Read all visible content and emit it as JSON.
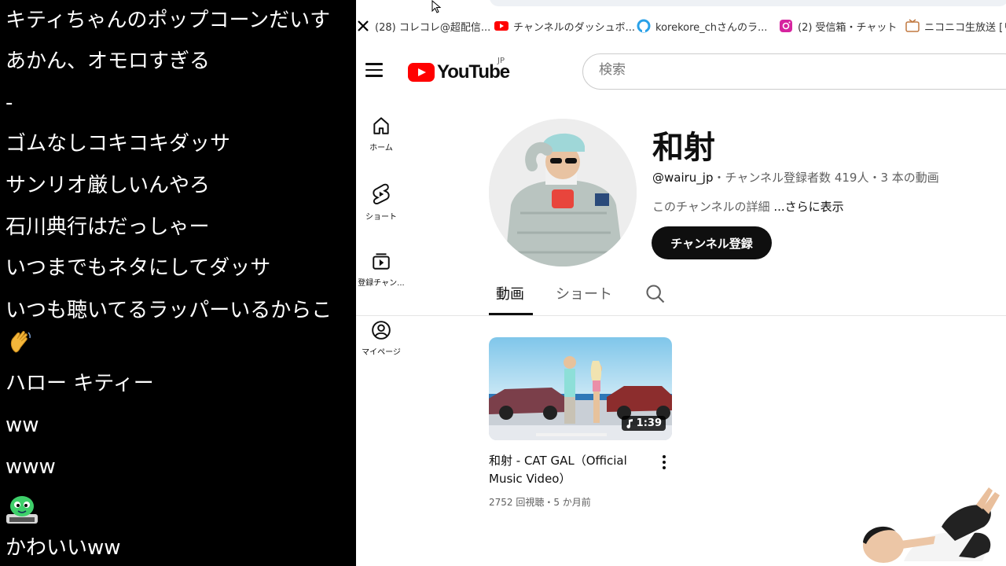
{
  "chat": {
    "messages": [
      {
        "text": "キティちゃんのポップコーンだいす"
      },
      {
        "text": "あかん、オモロすぎる"
      },
      {
        "text": "-"
      },
      {
        "text": "ゴムなしコキコキダッサ"
      },
      {
        "text": "サンリオ厳しいんやろ"
      },
      {
        "text": "石川典行はだっしゃー"
      },
      {
        "text": "いつまでもネタにしてダッサ"
      },
      {
        "text": "いつも聴いてるラッパーいるからこ"
      },
      {
        "text": "ハロー キティー"
      },
      {
        "text": "ww"
      },
      {
        "text": "www"
      },
      {
        "text": "かわいいww"
      }
    ],
    "emojis": [
      "waving-hand-icon",
      "green-character-sticker-icon"
    ]
  },
  "browser": {
    "bookmarks": [
      {
        "label": "(28) コレコレ@超配信...",
        "icon": "x-logo-icon",
        "color": "#000000"
      },
      {
        "label": "チャンネルのダッシュボ...",
        "icon": "youtube-studio-icon",
        "color": "#ff0000"
      },
      {
        "label": "korekore_chさんのラ...",
        "icon": "twitcasting-icon",
        "color": "#2aa1e8"
      },
      {
        "label": "(2) 受信箱・チャット",
        "icon": "instagram-icon",
        "color": "#d6249f"
      },
      {
        "label": "ニコニコ生放送 [リ",
        "icon": "niconico-icon",
        "color": "#e0a060"
      }
    ]
  },
  "youtube": {
    "logo_text": "YouTube",
    "region": "JP",
    "search_placeholder": "検索",
    "guide": [
      {
        "label": "ホーム",
        "icon": "home-icon"
      },
      {
        "label": "ショート",
        "icon": "shorts-icon"
      },
      {
        "label": "登録チャン...",
        "icon": "subscriptions-icon"
      },
      {
        "label": "マイページ",
        "icon": "account-icon"
      }
    ],
    "channel": {
      "name": "和射",
      "handle": "@wairu_jp",
      "stats": "・チャンネル登録者数 419人・3 本の動画",
      "description": "このチャンネルの詳細",
      "more_link": "...さらに表示",
      "subscribe_label": "チャンネル登録"
    },
    "tabs": [
      {
        "label": "動画",
        "active": true
      },
      {
        "label": "ショート",
        "active": false
      }
    ],
    "video": {
      "title": "和射 - CAT GAL（Official Music Video）",
      "duration": "1:39",
      "meta": "2752 回視聴・5 か月前"
    }
  },
  "colors": {
    "youtube_red": "#ff0000",
    "subscribe_bg": "#0f0f0f",
    "chat_bg": "#000000"
  }
}
